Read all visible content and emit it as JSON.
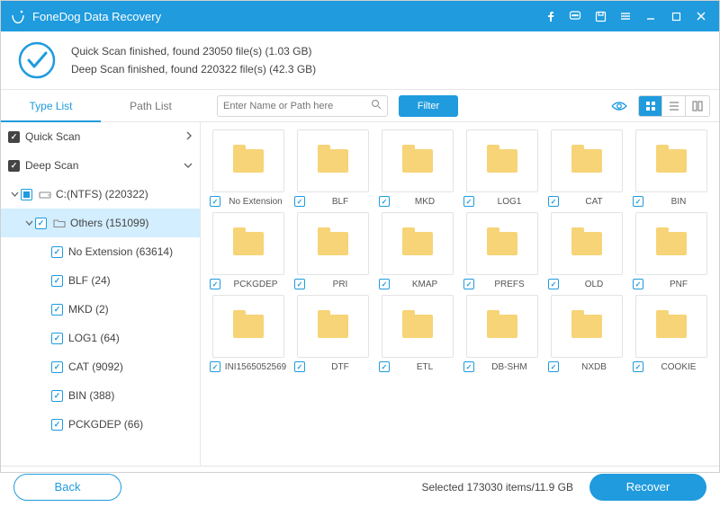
{
  "titlebar": {
    "title": "FoneDog Data Recovery"
  },
  "summary": {
    "line1": "Quick Scan finished, found 23050 file(s) (1.03 GB)",
    "line2": "Deep Scan finished, found 220322 file(s) (42.3 GB)"
  },
  "tabs": {
    "type_list": "Type List",
    "path_list": "Path List"
  },
  "search": {
    "placeholder": "Enter Name or Path here"
  },
  "filter_label": "Filter",
  "sidebar": {
    "quick_scan": "Quick Scan",
    "deep_scan": "Deep Scan",
    "drive": "C:(NTFS) (220322)",
    "others": "Others (151099)",
    "items": [
      "No Extension (63614)",
      "BLF (24)",
      "MKD (2)",
      "LOG1 (64)",
      "CAT (9092)",
      "BIN (388)",
      "PCKGDEP (66)"
    ]
  },
  "grid": {
    "items": [
      "No Extension",
      "BLF",
      "MKD",
      "LOG1",
      "CAT",
      "BIN",
      "PCKGDEP",
      "PRI",
      "KMAP",
      "PREFS",
      "OLD",
      "PNF",
      "INI1565052569",
      "DTF",
      "ETL",
      "DB-SHM",
      "NXDB",
      "COOKIE"
    ]
  },
  "footer": {
    "back": "Back",
    "selected": "Selected 173030 items/11.9 GB",
    "recover": "Recover"
  }
}
